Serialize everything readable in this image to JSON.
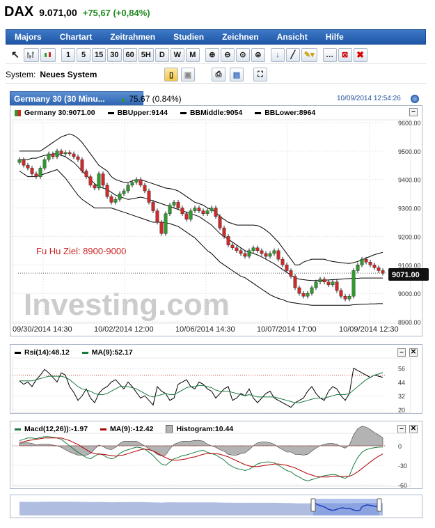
{
  "header": {
    "symbol": "DAX",
    "price": "9.071,00",
    "change": "+75,67 (+0,84%)"
  },
  "menu": [
    "Majors",
    "Chartart",
    "Zeitrahmen",
    "Studien",
    "Zeichnen",
    "Ansicht",
    "Hilfe"
  ],
  "toolbar": {
    "intervals": [
      "1",
      "5",
      "15",
      "30",
      "60",
      "5H",
      "D",
      "W",
      "M"
    ]
  },
  "system": {
    "label": "System:",
    "value": "Neues System"
  },
  "chart_tab": {
    "title": "Germany 30 (30 Minu...",
    "change": "75.67 (0.84%)",
    "datetime": "10/09/2014 12:54:26"
  },
  "colors": {
    "up": "#2e9a2e",
    "down": "#d12828",
    "band": "#000000",
    "ma": "#1a7a3e",
    "macd_ma": "#b00000",
    "hist": "#b3b3b3",
    "nav_fill": "#aebde0",
    "nav_line": "#2040c0"
  },
  "chart_data": [
    {
      "type": "candlestick",
      "legend": [
        "Germany 30:9071.00",
        "BBUpper:9144",
        "BBMiddle:9054",
        "BBLower:8964"
      ],
      "annotation": "Fu Hu Ziel:  8900-9000",
      "watermark": "Investing.com",
      "last_price": "9071.00",
      "last_value": 9071,
      "ylim": [
        8900,
        9600
      ],
      "yticks": [
        "9600.00",
        "9500.00",
        "9400.00",
        "9300.00",
        "9200.00",
        "9100.00",
        "9000.00",
        "8900.00"
      ],
      "xticks": [
        "09/30/2014 14:30",
        "10/02/2014 12:00",
        "10/06/2014 14:30",
        "10/07/2014 17:00",
        "10/09/2014 12:30"
      ],
      "close": [
        9470,
        9450,
        9440,
        9420,
        9410,
        9440,
        9470,
        9490,
        9480,
        9500,
        9490,
        9495,
        9490,
        9480,
        9470,
        9430,
        9410,
        9380,
        9370,
        9420,
        9380,
        9340,
        9320,
        9330,
        9350,
        9360,
        9380,
        9390,
        9400,
        9380,
        9360,
        9320,
        9290,
        9250,
        9210,
        9280,
        9310,
        9320,
        9300,
        9280,
        9260,
        9290,
        9300,
        9290,
        9280,
        9290,
        9300,
        9270,
        9230,
        9200,
        9170,
        9160,
        9150,
        9140,
        9130,
        9150,
        9160,
        9150,
        9140,
        9130,
        9140,
        9150,
        9120,
        9100,
        9080,
        9060,
        9020,
        9000,
        8990,
        9000,
        9020,
        9040,
        9050,
        9040,
        9030,
        9040,
        9010,
        8990,
        8980,
        8990,
        9080,
        9100,
        9120,
        9110,
        9100,
        9090,
        9080,
        9071
      ],
      "bb_upper": [
        9500,
        9500,
        9500,
        9500,
        9500,
        9500,
        9510,
        9520,
        9530,
        9540,
        9550,
        9555,
        9560,
        9555,
        9545,
        9530,
        9510,
        9490,
        9470,
        9450,
        9440,
        9430,
        9410,
        9400,
        9395,
        9390,
        9390,
        9395,
        9400,
        9398,
        9395,
        9390,
        9385,
        9380,
        9375,
        9370,
        9368,
        9365,
        9360,
        9350,
        9340,
        9330,
        9320,
        9315,
        9310,
        9300,
        9295,
        9285,
        9270,
        9260,
        9250,
        9245,
        9240,
        9240,
        9240,
        9240,
        9240,
        9238,
        9232,
        9222,
        9210,
        9195,
        9180,
        9160,
        9140,
        9120,
        9100,
        9100,
        9110,
        9115,
        9120,
        9120,
        9120,
        9120,
        9115,
        9112,
        9110,
        9108,
        9106,
        9105,
        9108,
        9112,
        9118,
        9124,
        9130,
        9136,
        9140,
        9144
      ],
      "bb_middle": [
        9470,
        9470,
        9470,
        9475,
        9475,
        9480,
        9485,
        9485,
        9490,
        9490,
        9485,
        9480,
        9470,
        9460,
        9445,
        9430,
        9415,
        9400,
        9385,
        9375,
        9370,
        9365,
        9355,
        9345,
        9340,
        9335,
        9330,
        9332,
        9335,
        9338,
        9335,
        9330,
        9325,
        9320,
        9315,
        9310,
        9305,
        9300,
        9295,
        9290,
        9285,
        9280,
        9275,
        9270,
        9260,
        9250,
        9240,
        9225,
        9210,
        9200,
        9190,
        9180,
        9170,
        9160,
        9150,
        9145,
        9140,
        9135,
        9128,
        9120,
        9112,
        9104,
        9094,
        9084,
        9074,
        9064,
        9054,
        9050,
        9048,
        9046,
        9045,
        9045,
        9045,
        9046,
        9047,
        9048,
        9049,
        9050,
        9051,
        9052,
        9053,
        9053,
        9054,
        9054,
        9054,
        9054,
        9054,
        9054
      ],
      "bb_lower": [
        9430,
        9420,
        9410,
        9410,
        9410,
        9415,
        9420,
        9425,
        9430,
        9435,
        9420,
        9405,
        9385,
        9365,
        9345,
        9330,
        9320,
        9310,
        9300,
        9300,
        9300,
        9300,
        9300,
        9295,
        9290,
        9285,
        9280,
        9275,
        9270,
        9265,
        9260,
        9255,
        9250,
        9250,
        9250,
        9248,
        9245,
        9240,
        9235,
        9225,
        9215,
        9205,
        9195,
        9180,
        9165,
        9150,
        9140,
        9125,
        9110,
        9100,
        9090,
        9080,
        9070,
        9060,
        9055,
        9045,
        9035,
        9025,
        9015,
        9005,
        8995,
        8988,
        8982,
        8978,
        8972,
        8968,
        8966,
        8964,
        8962,
        8960,
        8958,
        8958,
        8958,
        8958,
        8958,
        8958,
        8958,
        8958,
        8958,
        8958,
        8960,
        8961,
        8962,
        8962,
        8963,
        8963,
        8964,
        8964
      ],
      "marker_prices": [
        8990,
        9110,
        9150,
        9200
      ]
    },
    {
      "type": "line",
      "legend": [
        "Rsi(14):48.12",
        "MA(9):52.17"
      ],
      "ylim": [
        20,
        60
      ],
      "yticks": [
        "56",
        "44",
        "32",
        "20"
      ],
      "reference": 50,
      "rsi": [
        45,
        42,
        44,
        40,
        46,
        50,
        55,
        52,
        48,
        44,
        52,
        50,
        40,
        35,
        28,
        32,
        38,
        30,
        26,
        34,
        38,
        40,
        44,
        46,
        42,
        38,
        44,
        40,
        35,
        30,
        32,
        28,
        24,
        40,
        36,
        34,
        28,
        30,
        42,
        44,
        46,
        40,
        38,
        44,
        42,
        38,
        36,
        30,
        34,
        38,
        40,
        28,
        30,
        34,
        32,
        38,
        30,
        26,
        30,
        34,
        36,
        30,
        28,
        26,
        24,
        22,
        26,
        28,
        30,
        36,
        40,
        34,
        30,
        28,
        36,
        40,
        38,
        32,
        28,
        34,
        56,
        54,
        52,
        50,
        48,
        50,
        49,
        48.12
      ],
      "ma": [
        45,
        45,
        45,
        45,
        46,
        47,
        48,
        49,
        49,
        49,
        49,
        48,
        46,
        43,
        40,
        38,
        37,
        36,
        34,
        33,
        33,
        34,
        36,
        38,
        40,
        40,
        40,
        39,
        38,
        36,
        34,
        32,
        31,
        32,
        33,
        34,
        33,
        33,
        35,
        37,
        39,
        40,
        40,
        41,
        41,
        40,
        39,
        37,
        36,
        36,
        36,
        35,
        34,
        33,
        32,
        33,
        32,
        31,
        31,
        31,
        31,
        31,
        30,
        29,
        28,
        27,
        26,
        26,
        27,
        28,
        29,
        30,
        30,
        30,
        31,
        32,
        33,
        33,
        33,
        34,
        37,
        40,
        43,
        46,
        48,
        50,
        51,
        52.17
      ]
    },
    {
      "type": "line",
      "legend": [
        "Macd(12,26)):-1.97",
        "MA(9):-12.42",
        "Histogram:10.44"
      ],
      "ylim": [
        -60,
        15
      ],
      "yticks": [
        "0",
        "-30",
        "-60"
      ],
      "macd": [
        8,
        10,
        12,
        12,
        11,
        13,
        14,
        14,
        13,
        12,
        10,
        5,
        0,
        -5,
        -10,
        -14,
        -18,
        -20,
        -16,
        -12,
        -14,
        -18,
        -20,
        -18,
        -12,
        -8,
        -6,
        -4,
        -2,
        -3,
        -5,
        -10,
        -15,
        -22,
        -28,
        -30,
        -25,
        -20,
        -18,
        -15,
        -14,
        -12,
        -10,
        -8,
        -7,
        -10,
        -12,
        -14,
        -18,
        -22,
        -28,
        -32,
        -35,
        -36,
        -38,
        -36,
        -32,
        -28,
        -26,
        -25,
        -25,
        -26,
        -30,
        -34,
        -38,
        -40,
        -45,
        -48,
        -52,
        -54,
        -52,
        -50,
        -48,
        -46,
        -45,
        -44,
        -45,
        -48,
        -50,
        -46,
        -30,
        -18,
        -10,
        -6,
        -4,
        -3,
        -2,
        -1.97
      ],
      "signal": [
        5,
        6,
        8,
        9,
        10,
        11,
        12,
        12,
        12,
        12,
        12,
        10,
        8,
        5,
        2,
        -2,
        -6,
        -10,
        -12,
        -13,
        -13,
        -14,
        -15,
        -16,
        -15,
        -14,
        -12,
        -10,
        -8,
        -6,
        -5,
        -6,
        -8,
        -11,
        -15,
        -18,
        -21,
        -22,
        -22,
        -21,
        -20,
        -18,
        -17,
        -15,
        -13,
        -12,
        -12,
        -12,
        -13,
        -15,
        -17,
        -20,
        -23,
        -26,
        -29,
        -31,
        -32,
        -32,
        -31,
        -30,
        -29,
        -28,
        -28,
        -29,
        -30,
        -32,
        -34,
        -37,
        -40,
        -43,
        -45,
        -47,
        -48,
        -48,
        -48,
        -47,
        -47,
        -47,
        -47,
        -47,
        -44,
        -40,
        -35,
        -30,
        -25,
        -20,
        -16,
        -12.42
      ]
    }
  ]
}
